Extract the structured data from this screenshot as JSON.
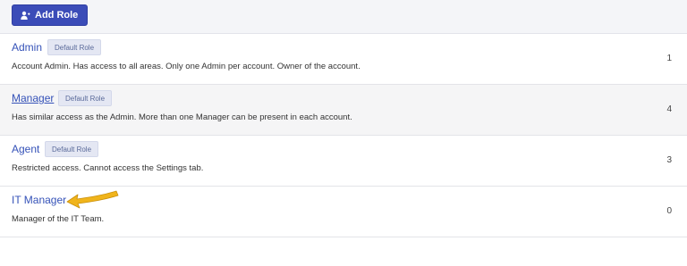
{
  "toolbar": {
    "add_role_label": "Add Role",
    "add_role_icon": "add-user-icon",
    "accent_color": "#3b4cb8"
  },
  "roles": [
    {
      "name": "Admin",
      "badge": "Default Role",
      "description": "Account Admin. Has access to all areas. Only one Admin per account. Owner of the account.",
      "count": "1"
    },
    {
      "name": "Manager",
      "badge": "Default Role",
      "description": "Has similar access as the Admin. More than one Manager can be present in each account.",
      "count": "4"
    },
    {
      "name": "Agent",
      "badge": "Default Role",
      "description": "Restricted access. Cannot access the Settings tab.",
      "count": "3"
    },
    {
      "name": "IT Manager",
      "badge": "",
      "description": "Manager of the IT Team.",
      "count": "0"
    }
  ],
  "annotation": {
    "icon": "arrow-pointer-icon",
    "color": "#f0b41b"
  }
}
